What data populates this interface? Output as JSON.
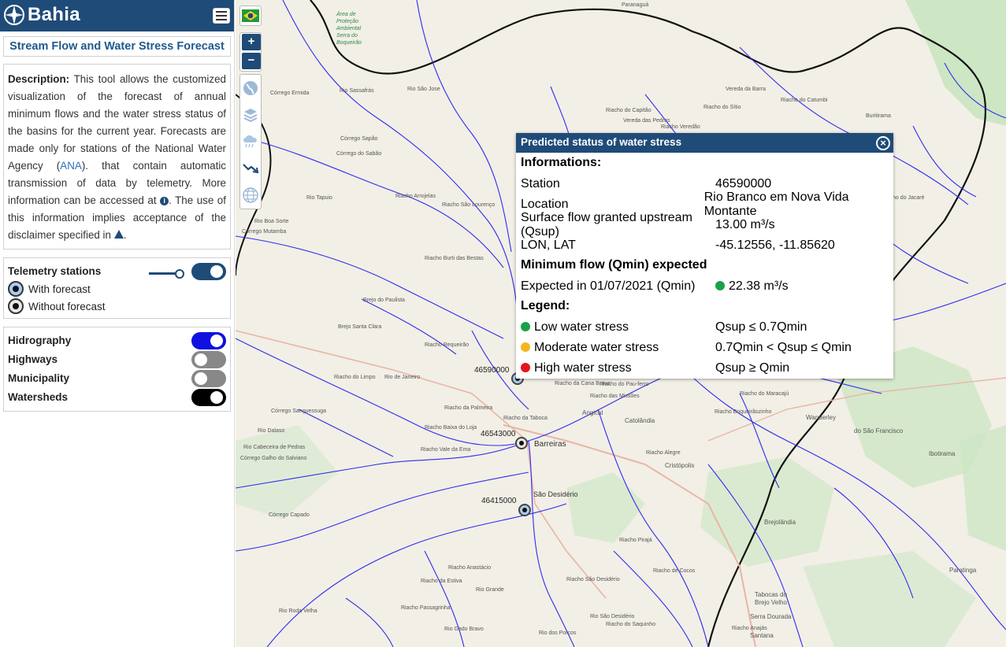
{
  "sidebar": {
    "brand": "Bahia",
    "title": "Stream Flow and Water Stress Forecast",
    "description": {
      "label": "Description:",
      "text_1": " This tool allows the customized visualization of the forecast of annual minimum flows and the water stress status of the basins for the current year. Forecasts are made only for stations of the National Water Agency (",
      "link": "ANA",
      "text_2": "). that contain automatic transmission of data by telemetry. More information can be accessed at ",
      "text_3": ". The use of this information implies acceptance of the disclaimer specified in ",
      "text_4": "."
    },
    "telemetry": {
      "title": "Telemetry stations",
      "with_forecast": "With forecast",
      "without_forecast": "Without forecast",
      "opacity": 1.0,
      "enabled": true,
      "toggle_color": "#1f4b78"
    },
    "layers": [
      {
        "label": "Hidrography",
        "on": true,
        "color": "#1010e0"
      },
      {
        "label": "Highways",
        "on": false,
        "color": "#888888"
      },
      {
        "label": "Municipality",
        "on": false,
        "color": "#888888"
      },
      {
        "label": "Watersheds",
        "on": true,
        "color": "#000000"
      }
    ]
  },
  "map": {
    "controls": {
      "zoom_in": "+",
      "zoom_out": "−"
    },
    "tool_icons": [
      "globe-icon",
      "layers-icon",
      "rain-cloud-icon",
      "trend-icon",
      "world-icon"
    ],
    "stations": [
      {
        "code": "46590000",
        "type": "forecast"
      },
      {
        "code": "46543000",
        "type": "no-forecast"
      },
      {
        "code": "46415000",
        "type": "forecast"
      }
    ],
    "places": [
      "Paranaguá",
      "Área de Proteção Ambiental Serra do Boqueirão",
      "Córrego Ermida",
      "Rio Sassafrás",
      "Riacho do Capitão",
      "Vereda das Pedras",
      "Riacho do Sítio",
      "Riacho do Catumbi",
      "Vereda da Barra",
      "Buritirama",
      "Riacho do Jacaré",
      "Riacho do Limpo",
      "Riacho da Palmeira",
      "Riacho da Taboca",
      "Riacho Baixa do Loja",
      "Riacho Vale da Ema",
      "Barreiras",
      "São Desidério",
      "Riacho Alegre",
      "Cristópolis",
      "Angical",
      "Catolândia",
      "Riacho Boqueirãozinho",
      "Riacho do Maracajú",
      "Ibotirama",
      "do São Francisco",
      "Wanderley",
      "Brejolândia",
      "Tabocas do Brejo Velho",
      "Serra Dourada",
      "Paratinga",
      "Santana",
      "Riacho Pirajá",
      "Riacho da Estiva",
      "Rio Grande",
      "Riacho São Desidério",
      "Rio São Desidério",
      "Riacho Passagrinha",
      "Riacho Anastácio",
      "Rio Roda Velha",
      "Riacho de Cocos",
      "Rio Gado Bravo",
      "Rio dos Porcos",
      "Riacho do Saquinho",
      "Riacho Anajás",
      "Córrego Mutamba",
      "Córrego Capado",
      "Córrego Galho do Salviano",
      "Rio Cabeceira de Pedras",
      "Córrego Sanguessuga",
      "Rio Dalaso",
      "Riacho Arrojelas",
      "Riacho São Lourenço",
      "Brejo do Paulista",
      "Brejo Santa Clara",
      "Riacho Requeirão",
      "Rio Tapuio",
      "Córrego Sapão",
      "Córrego do Sabão",
      "Rio de Janeiro",
      "Riacho Burti das Bestas",
      "Rio São Jose",
      "Rio Boa Sorte",
      "Riacho da Cana Brava",
      "Riacho do Pau-ferro",
      "Riacho das Missões",
      "Riacho Veredão"
    ],
    "popup": {
      "title": "Predicted status of water stress",
      "info_heading": "Informations:",
      "rows": [
        {
          "k": "Station",
          "v": "46590000"
        },
        {
          "k": "Location",
          "v": "Rio Branco em Nova Vida Montante"
        },
        {
          "k": "Surface flow granted upstream (Qsup)",
          "v": "13.00 m³/s"
        },
        {
          "k": "LON, LAT",
          "v": "-45.12556, -11.85620"
        }
      ],
      "qmin_heading": "Minimum flow (Qmin) expected",
      "expected_label": "Expected in 01/07/2021 (Qmin)",
      "expected_value": "22.38 m³/s",
      "expected_color": "#1aa14a",
      "legend_heading": "Legend:",
      "legend": [
        {
          "label": "Low water stress",
          "rule": "Qsup ≤ 0.7Qmin",
          "color": "#1aa14a"
        },
        {
          "label": "Moderate water stress",
          "rule": "0.7Qmin < Qsup ≤ Qmin",
          "color": "#f2b71d"
        },
        {
          "label": "High water stress",
          "rule": "Qsup ≥ Qmin",
          "color": "#e3151a"
        }
      ]
    }
  }
}
